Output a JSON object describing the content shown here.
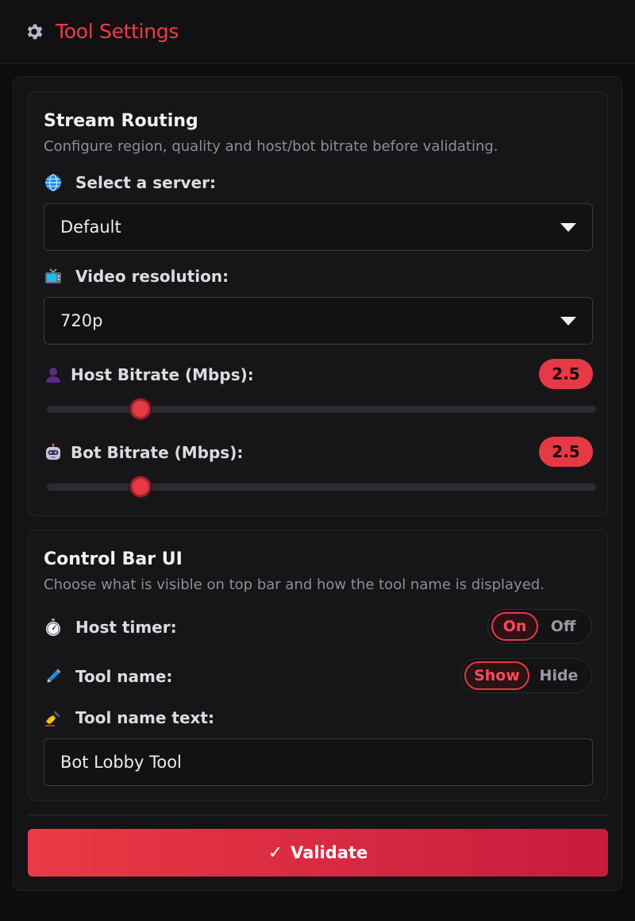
{
  "header": {
    "title": "Tool Settings",
    "icon": "gear-icon",
    "accent": "#ef3b4a"
  },
  "stream_routing": {
    "title": "Stream Routing",
    "subtitle": "Configure region, quality and host/bot bitrate before validating.",
    "server": {
      "label": "Select a server:",
      "icon": "globe-icon",
      "value": "Default"
    },
    "resolution": {
      "label": "Video resolution:",
      "icon": "tv-icon",
      "value": "720p"
    },
    "host_bitrate": {
      "label": "Host Bitrate (Mbps):",
      "icon": "user-icon",
      "value": "2.5",
      "slider_fraction": 0.17
    },
    "bot_bitrate": {
      "label": "Bot Bitrate (Mbps):",
      "icon": "robot-icon",
      "value": "2.5",
      "slider_fraction": 0.17
    }
  },
  "control_bar": {
    "title": "Control Bar UI",
    "subtitle": "Choose what is visible on top bar and how the tool name is displayed.",
    "host_timer": {
      "label": "Host timer:",
      "icon": "stopwatch-icon",
      "options": [
        "On",
        "Off"
      ],
      "selected": "On"
    },
    "tool_name": {
      "label": "Tool name:",
      "icon": "pen-icon",
      "options": [
        "Show",
        "Hide"
      ],
      "selected": "Show"
    },
    "tool_name_text": {
      "label": "Tool name text:",
      "icon": "writing-hand-icon",
      "value": "Bot Lobby Tool"
    }
  },
  "actions": {
    "validate_check": "✓",
    "validate_label": "Validate"
  },
  "colors": {
    "accent": "#e63946",
    "background": "#0d0d0f",
    "card": "#161618"
  }
}
